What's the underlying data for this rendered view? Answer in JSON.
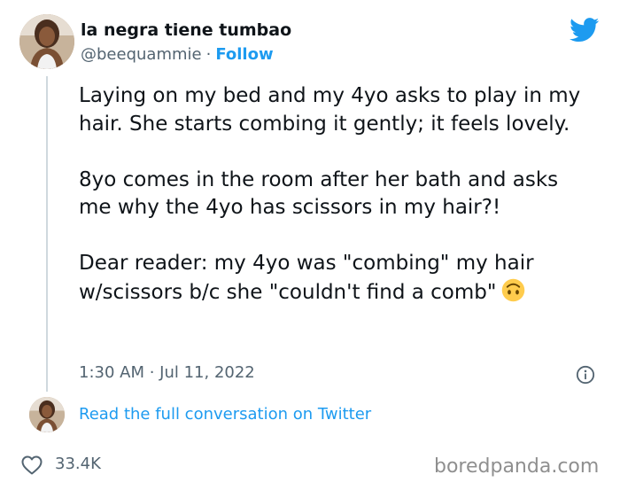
{
  "author": {
    "display_name": "la negra tiene tumbao",
    "handle": "@beequammie",
    "separator": "·",
    "follow_label": "Follow"
  },
  "tweet": {
    "paragraphs": [
      "Laying on my bed and my 4yo asks to play in my hair. She starts combing it gently; it feels lovely.",
      "8yo comes in the room after her bath and asks me why the 4yo has scissors in my hair?!",
      "Dear reader: my 4yo was \"combing\" my hair w/scissors b/c she \"couldn't find a comb\""
    ],
    "emoji": "upside-down-face",
    "timestamp": "1:30 AM · Jul 11, 2022"
  },
  "conversation": {
    "link_label": "Read the full conversation on Twitter"
  },
  "engagement": {
    "like_count": "33.4K"
  },
  "watermark": "boredpanda.com",
  "colors": {
    "accent": "#1d9bf0",
    "text": "#0f1419",
    "muted": "#536471",
    "thread_line": "#cfd9de",
    "emoji": "#ffcc4d"
  }
}
